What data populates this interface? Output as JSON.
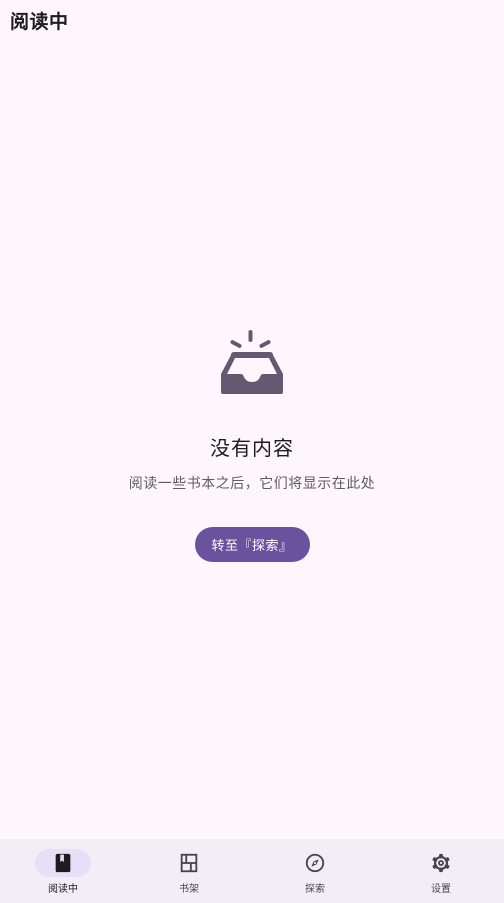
{
  "header": {
    "title": "阅读中"
  },
  "empty_state": {
    "icon": "inbox-icon",
    "title": "没有内容",
    "description": "阅读一些书本之后，它们将显示在此处",
    "button_label": "转至『探索』"
  },
  "bottom_nav": {
    "items": [
      {
        "label": "阅读中",
        "icon": "book-icon",
        "active": true
      },
      {
        "label": "书架",
        "icon": "bookshelf-icon",
        "active": false
      },
      {
        "label": "探索",
        "icon": "compass-icon",
        "active": false
      },
      {
        "label": "设置",
        "icon": "gear-icon",
        "active": false
      }
    ]
  },
  "colors": {
    "background": "#fdf7fd",
    "accent": "#6b529f",
    "nav_background": "#f3edf6",
    "nav_active_pill": "#e8def8",
    "icon": "#635a72"
  }
}
